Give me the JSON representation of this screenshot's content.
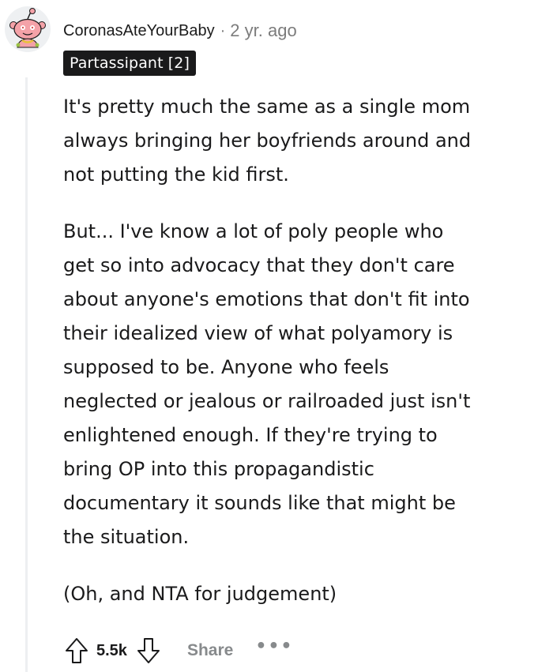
{
  "comment": {
    "username": "CoronasAteYourBaby",
    "separator": "·",
    "time": "2 yr. ago",
    "flair": "Partassipant [2]",
    "paragraphs": [
      {
        "lines": [
          "It's pretty much the same as a single mom",
          "always bringing her boyfriends around and",
          "not putting the kid first."
        ]
      },
      {
        "lines": [
          "But... I've know a lot of poly people who",
          "get so into advocacy that they don't care",
          "about anyone's emotions that don't fit into",
          "their idealized view of what polyamory is",
          "supposed to be. Anyone who feels",
          "neglected or jealous or railroaded just isn't",
          "enlightened enough. If they're trying to",
          "bring OP into this propagandistic",
          "documentary it sounds like that might be",
          "the situation."
        ]
      },
      {
        "lines": [
          "(Oh, and NTA for judgement)"
        ]
      }
    ],
    "actions": {
      "score": "5.5k",
      "share_label": "Share",
      "more_label": "•••"
    },
    "icons": {
      "avatar": "snoo-avatar-icon",
      "upvote": "upvote-arrow-icon",
      "downvote": "downvote-arrow-icon",
      "more": "more-options-icon"
    },
    "colors": {
      "flair_bg": "#1a1a1b",
      "avatar_head": "#f4a2a8",
      "muted_text": "#878a8c"
    }
  }
}
